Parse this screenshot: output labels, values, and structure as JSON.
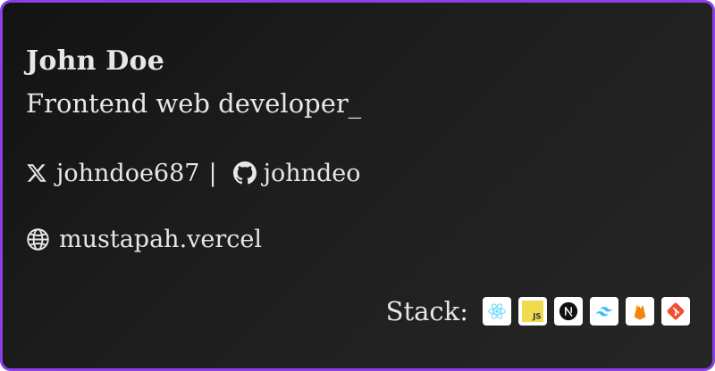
{
  "profile": {
    "name": "John Doe",
    "role": "Frontend web developer_"
  },
  "socials": {
    "twitter": {
      "icon": "x-icon",
      "handle": "johndoe687"
    },
    "separator": "|",
    "github": {
      "icon": "github-icon",
      "handle": "johndeo"
    }
  },
  "website": {
    "icon": "globe-icon",
    "url": "mustapah.vercel"
  },
  "stack": {
    "label": "Stack:",
    "items": [
      {
        "icon": "react-icon",
        "color": "#61dafb"
      },
      {
        "icon": "javascript-icon",
        "color": "#f0db4f"
      },
      {
        "icon": "nextjs-icon",
        "color": "#000000"
      },
      {
        "icon": "tailwind-icon",
        "color": "#38bdf8"
      },
      {
        "icon": "firebase-icon",
        "color": "#f57c00"
      },
      {
        "icon": "git-icon",
        "color": "#f05032"
      }
    ],
    "js_text": "JS"
  },
  "colors": {
    "border": "#8b3fe6",
    "background": "#1c1c1c",
    "text": "#e7e7e7"
  }
}
